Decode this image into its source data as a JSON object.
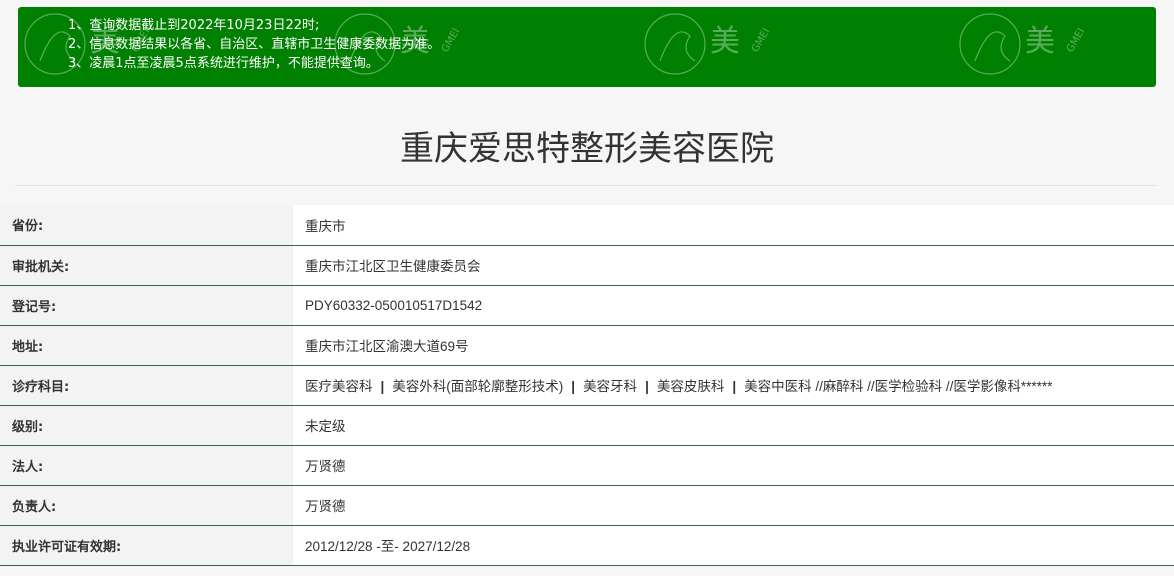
{
  "notice": {
    "lines": [
      "1、查询数据截止到2022年10月23日22时;",
      "2、信息数据结果以各省、自治区、直辖市卫生健康委数据为准。",
      "3、凌晨1点至凌晨5点系统进行维护，不能提供查询。"
    ],
    "background": "#008000"
  },
  "watermark": {
    "text": "美",
    "subtext": "GMEI"
  },
  "page_title": "重庆爱思特整形美容医院",
  "rows": [
    {
      "label": "省份:",
      "value": "重庆市"
    },
    {
      "label": "审批机关:",
      "value": "重庆市江北区卫生健康委员会"
    },
    {
      "label": "登记号:",
      "value": "PDY60332-050010517D1542"
    },
    {
      "label": "地址:",
      "value": "重庆市江北区渝澳大道69号"
    },
    {
      "label": "诊疗科目:",
      "value_items": [
        "医疗美容科",
        "美容外科(面部轮廓整形技术)",
        "美容牙科",
        "美容皮肤科",
        "美容中医科 //麻醉科 //医学检验科 //医学影像科******"
      ]
    },
    {
      "label": "级别:",
      "value": "未定级"
    },
    {
      "label": "法人:",
      "value": "万贤德"
    },
    {
      "label": "负责人:",
      "value": "万贤德"
    },
    {
      "label": "执业许可证有效期:",
      "value": "2012/12/28 -至- 2027/12/28"
    }
  ],
  "colors": {
    "row_border": "#2e6b45",
    "label_bg": "#f3f3f3",
    "value_bg": "#ffffff"
  }
}
